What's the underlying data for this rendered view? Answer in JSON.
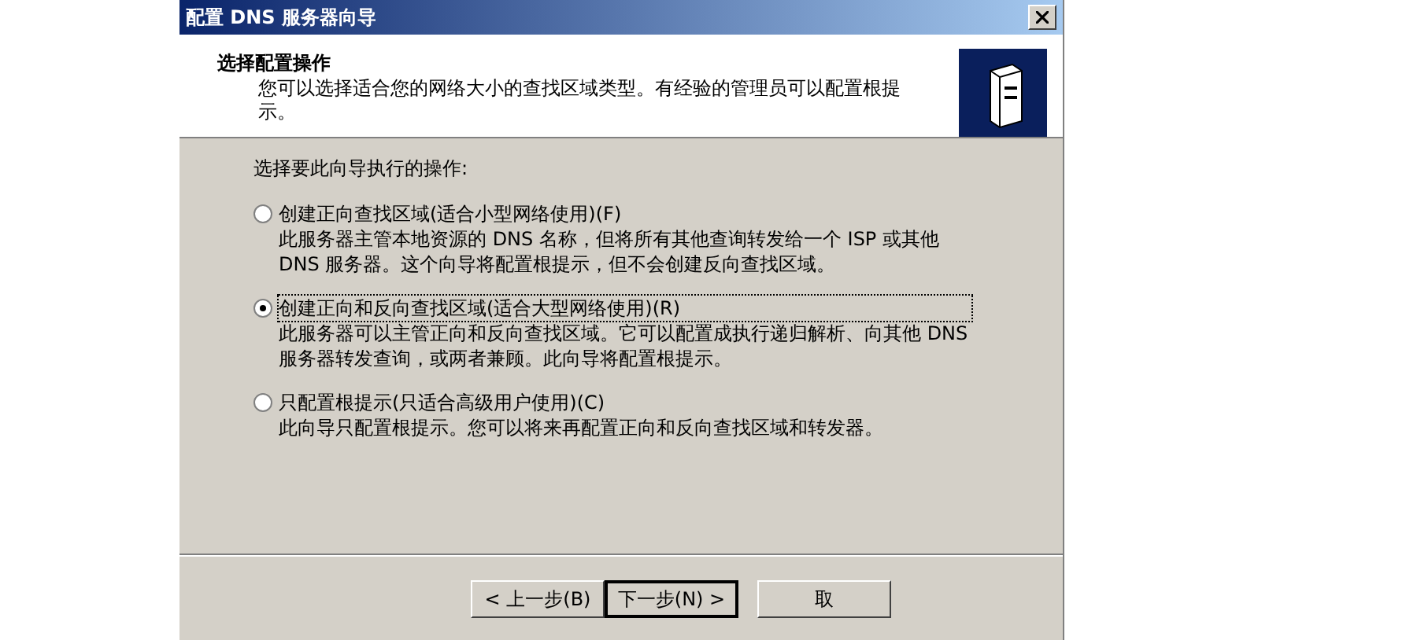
{
  "window": {
    "title": "配置 DNS 服务器向导"
  },
  "header": {
    "title": "选择配置操作",
    "description": "您可以选择适合您的网络大小的查找区域类型。有经验的管理员可以配置根提示。"
  },
  "prompt": "选择要此向导执行的操作:",
  "options": [
    {
      "label": "创建正向查找区域(适合小型网络使用)(F)",
      "description": "此服务器主管本地资源的 DNS 名称，但将所有其他查询转发给一个 ISP 或其他 DNS 服务器。这个向导将配置根提示，但不会创建反向查找区域。",
      "selected": false
    },
    {
      "label": "创建正向和反向查找区域(适合大型网络使用)(R)",
      "description": "此服务器可以主管正向和反向查找区域。它可以配置成执行递归解析、向其他 DNS 服务器转发查询，或两者兼顾。此向导将配置根提示。",
      "selected": true
    },
    {
      "label": "只配置根提示(只适合高级用户使用)(C)",
      "description": "此向导只配置根提示。您可以将来再配置正向和反向查找区域和转发器。",
      "selected": false
    }
  ],
  "buttons": [
    {
      "label": "< 上一步(B)",
      "kind": "back"
    },
    {
      "label": "下一步(N) >",
      "kind": "next"
    },
    {
      "label": "取",
      "kind": "cancel"
    }
  ]
}
